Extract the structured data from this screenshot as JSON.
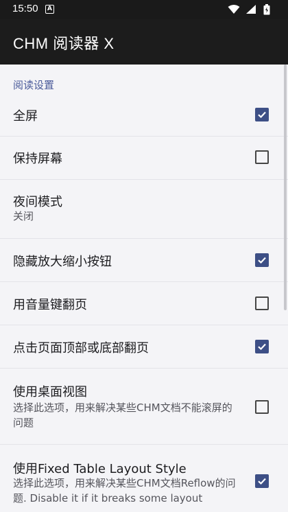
{
  "status_bar": {
    "time": "15:50",
    "notification_letter": "A"
  },
  "app_bar": {
    "title": "CHM 阅读器 X"
  },
  "section": {
    "header": "阅读设置"
  },
  "settings": [
    {
      "title": "全屏",
      "checked": true
    },
    {
      "title": "保持屏幕",
      "checked": false
    },
    {
      "title": "夜间模式",
      "summary": "关闭"
    },
    {
      "title": "隐藏放大缩小按钮",
      "checked": true
    },
    {
      "title": "用音量键翻页",
      "checked": false
    },
    {
      "title": "点击页面顶部或底部翻页",
      "checked": true
    },
    {
      "title": "使用桌面视图",
      "summary": "选择此选项，用来解决某些CHM文档不能滚屏的问题",
      "checked": false
    },
    {
      "title": "使用Fixed Table Layout Style",
      "summary": "选择此选项，用来解决某些CHM文档Reflow的问题. Disable it if it breaks some layout",
      "checked": true
    }
  ],
  "colors": {
    "accent": "#3d4f86",
    "section_header": "#4a5a9a",
    "appbar": "#1c1c1c",
    "background": "#f4f4f7"
  }
}
